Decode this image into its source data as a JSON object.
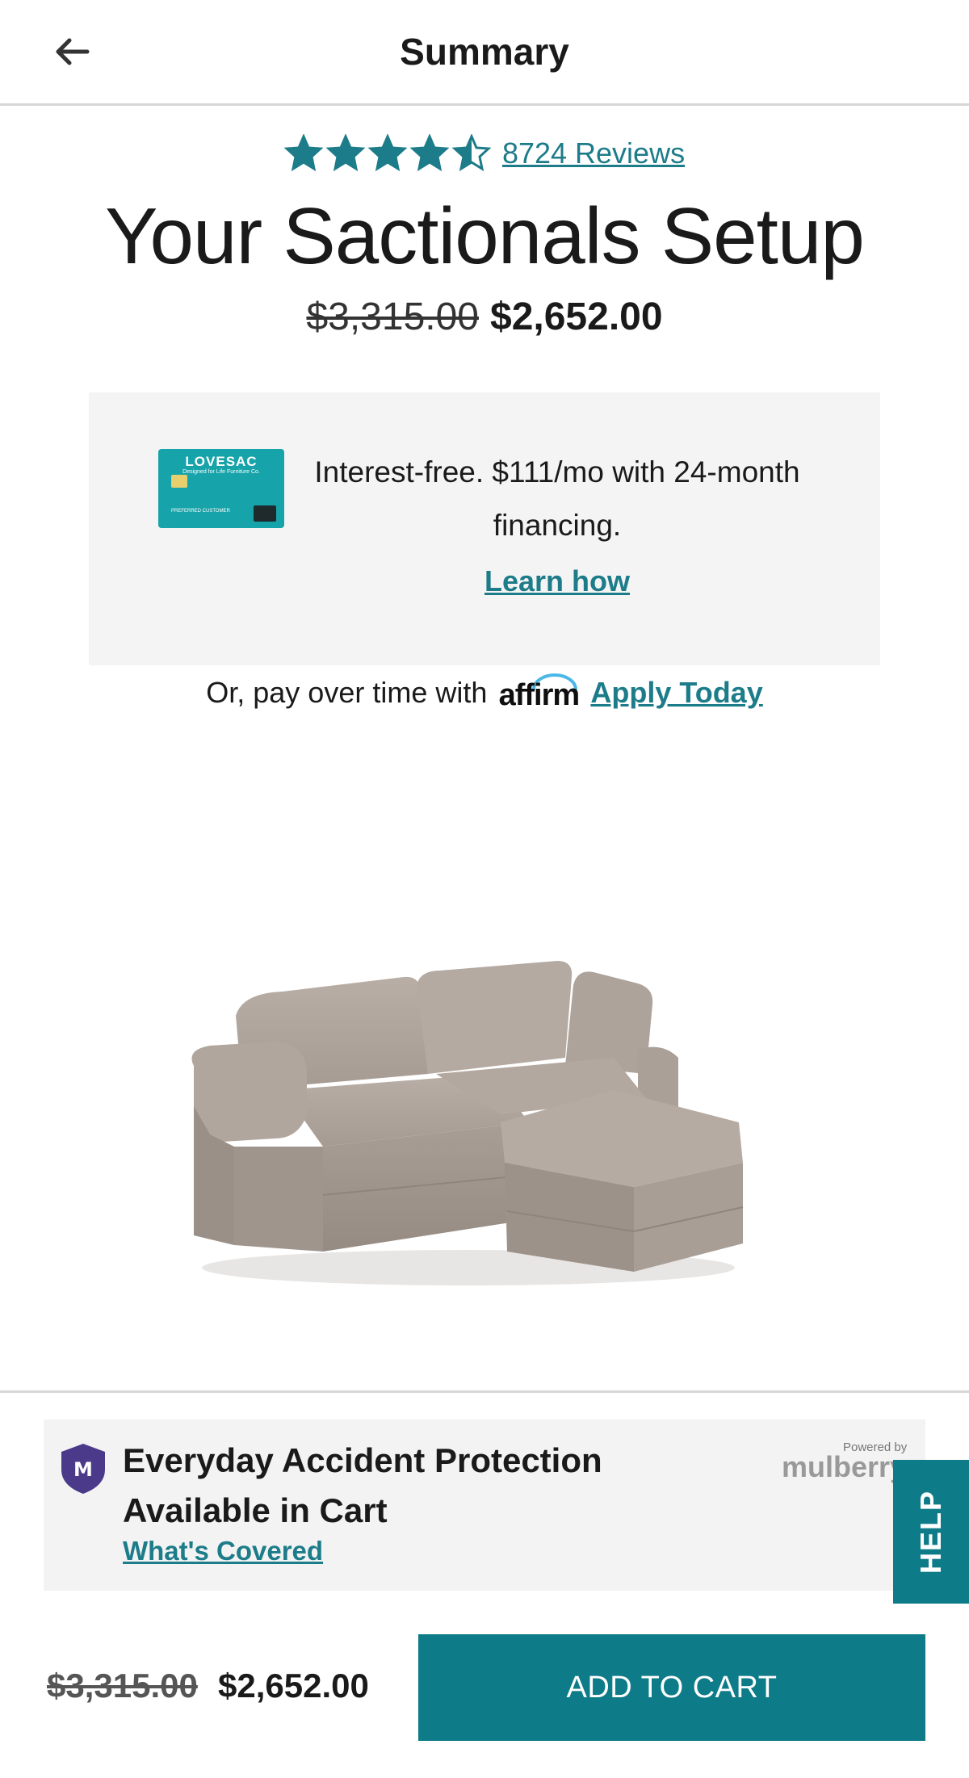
{
  "header": {
    "title": "Summary",
    "back_icon": "arrow-left-icon"
  },
  "rating": {
    "stars": 4.5,
    "out_of": 5,
    "reviews_label": "8724 Reviews",
    "star_color": "#1d7c89"
  },
  "setup_title": "Your Sactionals Setup",
  "price": {
    "original": "$3,315.00",
    "current": "$2,652.00"
  },
  "financing": {
    "card": {
      "brand": "LOVESAC",
      "tagline": "Designed for Life Furniture Co.",
      "customer_label": "PREFERRED CUSTOMER"
    },
    "text": "Interest-free. $111/mo with 24-month financing.",
    "learn_label": "Learn how"
  },
  "affirm": {
    "prefix": "Or, pay over time with",
    "logo_text": "affirm",
    "apply_label": "Apply Today"
  },
  "product": {
    "image_alt": "sectional-sofa"
  },
  "protection": {
    "title": "Everyday Accident Protection Available in Cart",
    "covered_label": "What's Covered",
    "powered_label": "Powered by",
    "provider": "mulberry",
    "shield_letter": "M"
  },
  "help_label": "HELP",
  "bottom": {
    "original": "$3,315.00",
    "current": "$2,652.00",
    "cart_label": "ADD TO CART"
  },
  "colors": {
    "accent": "#0d7b88",
    "link": "#1d7c89",
    "panel": "#f4f4f4"
  }
}
